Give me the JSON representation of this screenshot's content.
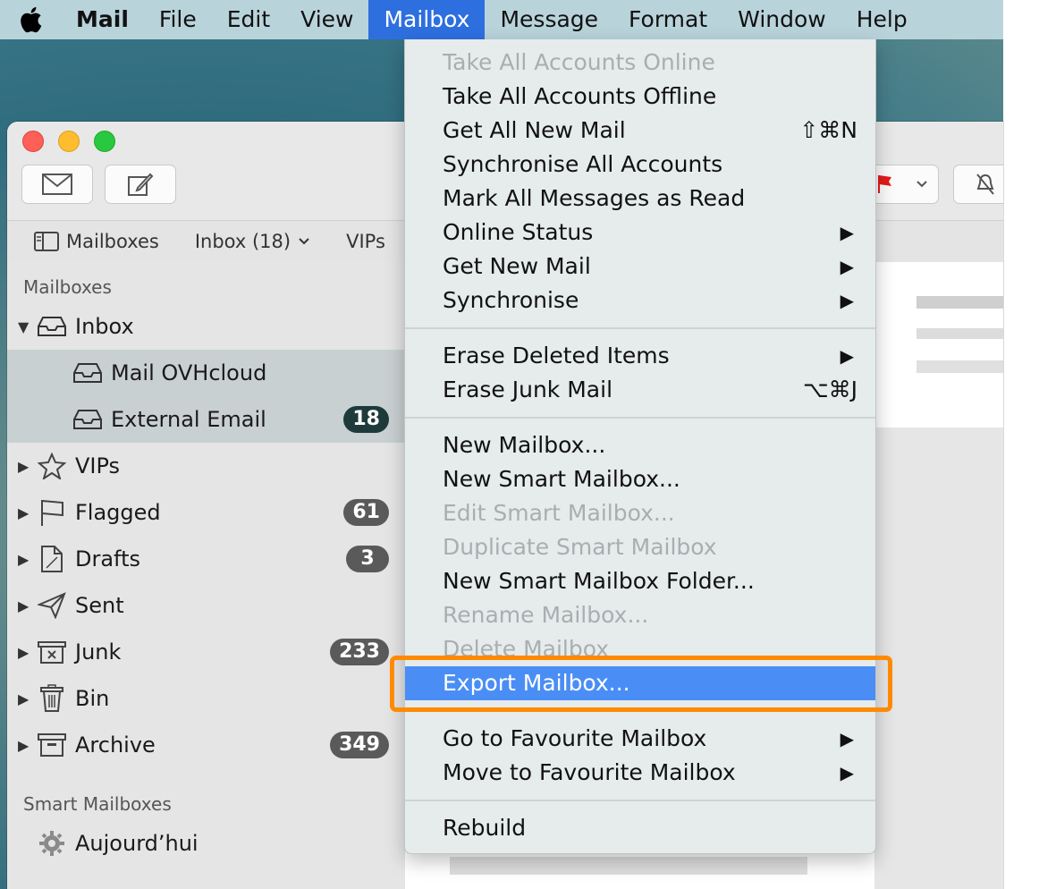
{
  "menubar": {
    "app": "Mail",
    "items": [
      "File",
      "Edit",
      "View",
      "Mailbox",
      "Message",
      "Format",
      "Window",
      "Help"
    ],
    "active": "Mailbox"
  },
  "favorites_bar": {
    "mailboxes": "Mailboxes",
    "inbox": "Inbox (18)",
    "vips": "VIPs"
  },
  "sidebar": {
    "header": "Mailboxes",
    "inbox": "Inbox",
    "accounts": [
      {
        "label": "Mail OVHcloud"
      },
      {
        "label": "External Email",
        "badge": "18"
      }
    ],
    "items": [
      {
        "label": "VIPs",
        "icon": "star-icon"
      },
      {
        "label": "Flagged",
        "icon": "flag-icon",
        "badge": "61"
      },
      {
        "label": "Drafts",
        "icon": "draft-icon",
        "badge": "3"
      },
      {
        "label": "Sent",
        "icon": "paper-plane-icon"
      },
      {
        "label": "Junk",
        "icon": "junk-icon",
        "badge": "233"
      },
      {
        "label": "Bin",
        "icon": "trash-icon"
      },
      {
        "label": "Archive",
        "icon": "archive-icon",
        "badge": "349"
      }
    ],
    "smart_header": "Smart Mailboxes",
    "smart_items": [
      {
        "label": "Aujourd’hui",
        "icon": "gear-icon"
      }
    ]
  },
  "menu": {
    "items": [
      {
        "label": "Take All Accounts Online",
        "disabled": true
      },
      {
        "label": "Take All Accounts Offline"
      },
      {
        "label": "Get All New Mail",
        "shortcut": "⇧⌘N"
      },
      {
        "label": "Synchronise All Accounts"
      },
      {
        "label": "Mark All Messages as Read"
      },
      {
        "label": "Online Status",
        "submenu": true
      },
      {
        "label": "Get New Mail",
        "submenu": true
      },
      {
        "label": "Synchronise",
        "submenu": true
      },
      {
        "label": "Erase Deleted Items",
        "submenu": true
      },
      {
        "label": "Erase Junk Mail",
        "shortcut": "⌥⌘J"
      },
      {
        "label": "New Mailbox..."
      },
      {
        "label": "New Smart Mailbox..."
      },
      {
        "label": "Edit Smart Mailbox...",
        "disabled": true
      },
      {
        "label": "Duplicate Smart Mailbox",
        "disabled": true
      },
      {
        "label": "New Smart Mailbox Folder..."
      },
      {
        "label": "Rename Mailbox...",
        "disabled": true
      },
      {
        "label": "Delete Mailbox",
        "disabled": true
      },
      {
        "label": "Export Mailbox...",
        "highlighted": true
      },
      {
        "label": "Go to Favourite Mailbox",
        "submenu": true
      },
      {
        "label": "Move to Favourite Mailbox",
        "submenu": true
      },
      {
        "label": "Rebuild"
      }
    ],
    "submenu_arrow": "▶"
  },
  "colors": {
    "highlight_outline": "#ff8a00",
    "selection_blue": "#4a8ef5",
    "menubar_active": "#2e6fe0"
  }
}
